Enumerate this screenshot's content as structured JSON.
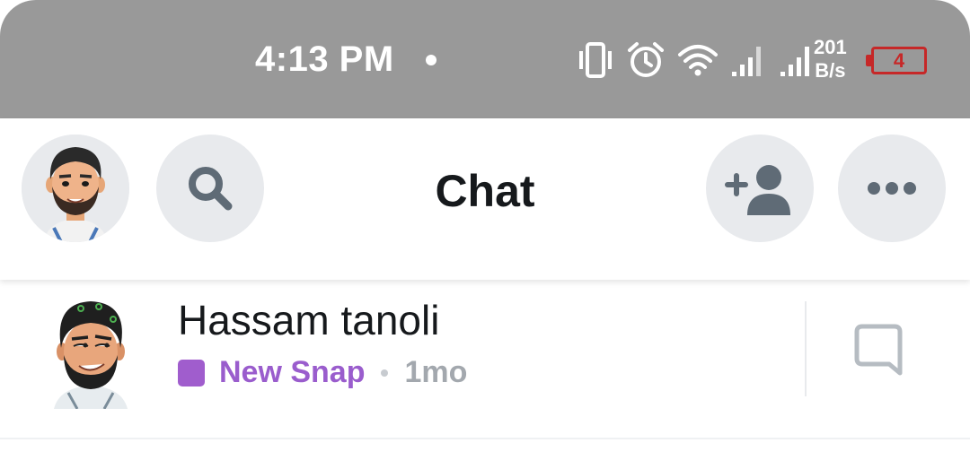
{
  "status_bar": {
    "time": "4:13 PM",
    "net_speed_value": "201",
    "net_speed_unit": "B/s",
    "battery_level": "4",
    "icons": [
      "vibrate-icon",
      "alarm-icon",
      "wifi-icon",
      "signal-icon",
      "signal-icon"
    ]
  },
  "header": {
    "title": "Chat",
    "buttons": [
      "profile-avatar",
      "search-icon",
      "add-friend-icon",
      "more-icon"
    ]
  },
  "chats": [
    {
      "name": "Hassam tanoli",
      "status": "New Snap",
      "time": "1mo"
    }
  ],
  "colors": {
    "status_bar_bg": "#999999",
    "snap_purple": "#a05dcd",
    "button_bg": "#e8eaed",
    "battery_red": "#c62828"
  }
}
